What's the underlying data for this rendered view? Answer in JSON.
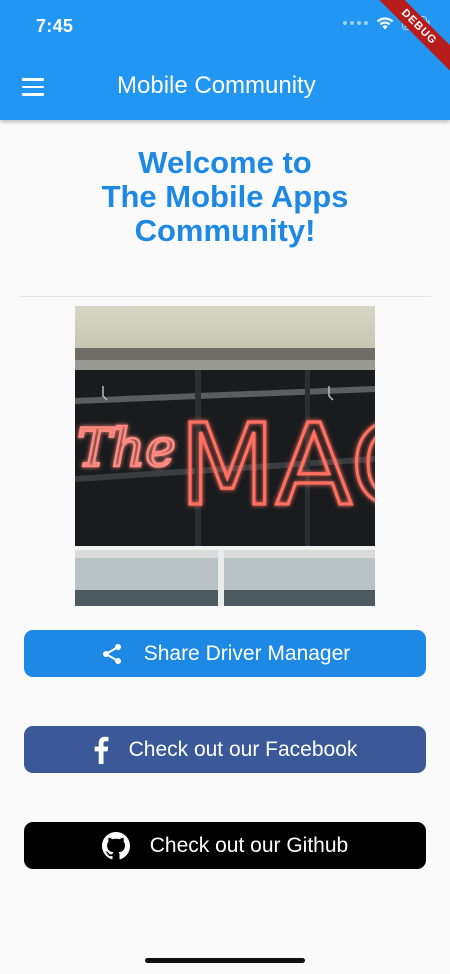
{
  "status_bar": {
    "time": "7:45",
    "debug_label": "DEBUG"
  },
  "app_bar": {
    "title": "Mobile Community",
    "menu_icon": "hamburger-menu-icon"
  },
  "welcome": {
    "lines": [
      "Welcome to",
      "The Mobile Apps",
      "Community!"
    ],
    "color": "#1e88e5"
  },
  "photo": {
    "sign_text": "The MAC"
  },
  "buttons": {
    "share": {
      "label": "Share Driver Manager",
      "icon": "share-icon",
      "color": "#1e88e5"
    },
    "facebook": {
      "label": "Check out our Facebook",
      "icon": "facebook-icon",
      "color": "#3b5998"
    },
    "github": {
      "label": "Check out our Github",
      "icon": "github-icon",
      "color": "#000000"
    }
  },
  "colors": {
    "app_bar": "#2196f3",
    "background": "#fafafa"
  }
}
